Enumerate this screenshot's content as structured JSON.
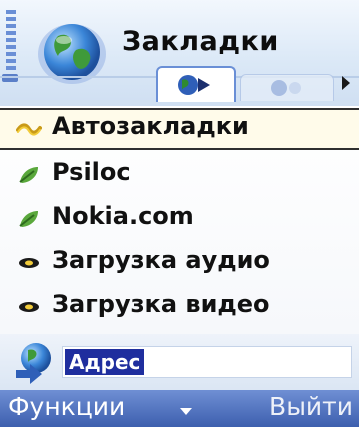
{
  "header": {
    "title": "Закладки",
    "tabs": [
      {
        "icon": "globe-bookmark-icon",
        "active": true
      },
      {
        "icon": "globe-icon",
        "active": false
      }
    ]
  },
  "list": {
    "selected_index": 0,
    "items": [
      {
        "label": "Автозакладки",
        "icon": "auto-bookmarks-icon"
      },
      {
        "label": "Psiloc",
        "icon": "bookmark-leaf-icon"
      },
      {
        "label": "Nokia.com",
        "icon": "bookmark-leaf-icon"
      },
      {
        "label": "Загрузка аудио",
        "icon": "download-icon"
      },
      {
        "label": "Загрузка видео",
        "icon": "download-icon"
      }
    ]
  },
  "address": {
    "value": "Адрес",
    "icon": "globe-go-icon"
  },
  "softkeys": {
    "left": "Функции",
    "right": "Выйти"
  },
  "colors": {
    "accent": "#3d5fae",
    "selection": "#1f2e9e",
    "leaf": "#5aa83c",
    "highlight_bar": "#fffbea"
  }
}
